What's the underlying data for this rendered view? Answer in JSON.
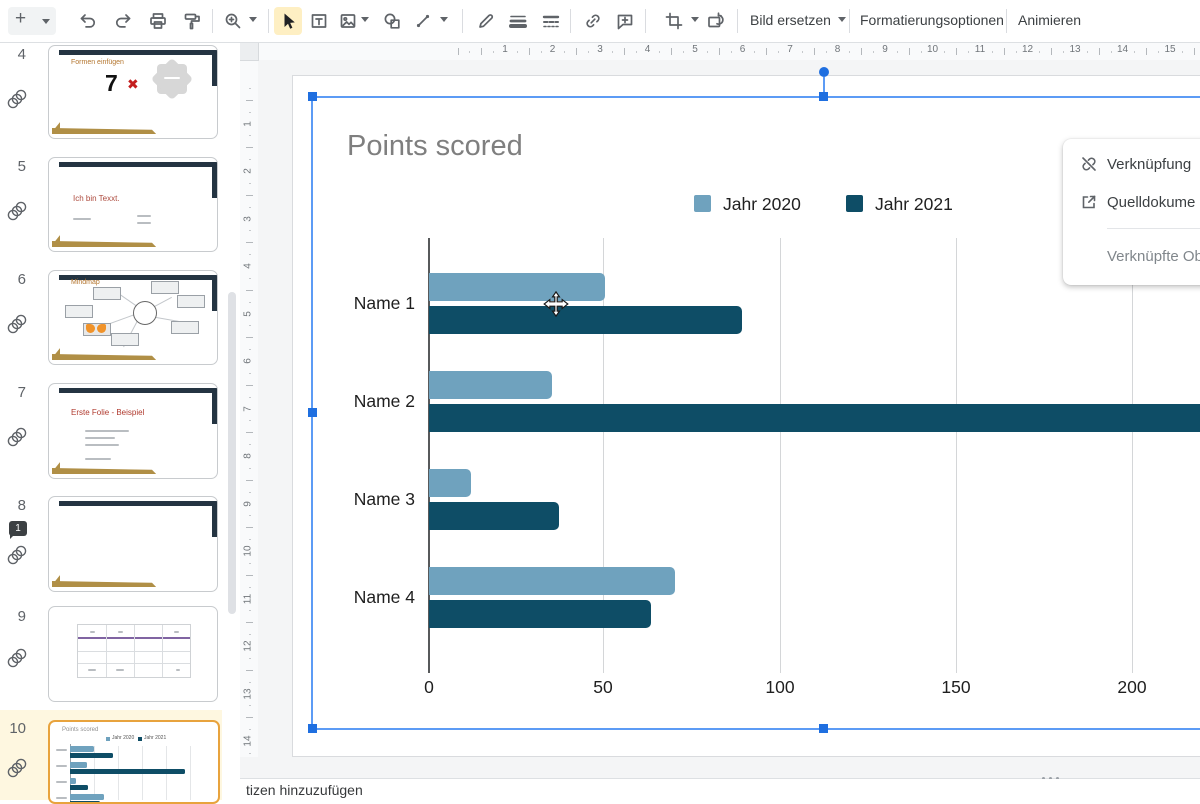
{
  "toolbar": {
    "buttons": {
      "replace_image": "Bild ersetzen",
      "format_options": "Formatierungsoptionen",
      "animate": "Animieren"
    },
    "icons": [
      "add-slide",
      "undo",
      "redo",
      "print",
      "paint-format",
      "zoom",
      "select-cursor",
      "text-box",
      "insert-image",
      "shape",
      "line",
      "border-color",
      "line-weight",
      "line-dash",
      "insert-link",
      "add-comment",
      "crop",
      "reset-image"
    ]
  },
  "rulers": {
    "horizontal": [
      "1",
      "2",
      "3",
      "4",
      "5",
      "6",
      "7",
      "8",
      "9",
      "10",
      "11",
      "12",
      "13",
      "14",
      "15"
    ],
    "vertical": [
      "1",
      "2",
      "3",
      "4",
      "5",
      "6",
      "7",
      "8",
      "9",
      "10",
      "11",
      "12",
      "13",
      "14"
    ]
  },
  "filmstrip": {
    "slides": [
      {
        "number": "4",
        "title": "Formen einfügen",
        "big_text": "7"
      },
      {
        "number": "5",
        "title": "Ich bin Texxt."
      },
      {
        "number": "6",
        "title": "Mindmap"
      },
      {
        "number": "7",
        "title": "Erste Folie - Beispiel"
      },
      {
        "number": "8",
        "comment_count": "1"
      },
      {
        "number": "9"
      },
      {
        "number": "10"
      }
    ]
  },
  "context_menu": {
    "items": [
      {
        "label": "Verknüpfung",
        "icon": "link-off-icon"
      },
      {
        "label": "Quelldokume",
        "icon": "open-in-new-icon"
      },
      {
        "label": "Verknüpfte Ob",
        "icon": null
      }
    ]
  },
  "notes": {
    "placeholder": "tizen hinzuzufügen"
  },
  "chart_data": {
    "type": "bar",
    "orientation": "horizontal",
    "title": "Points scored",
    "categories": [
      "Name 1",
      "Name 2",
      "Name 3",
      "Name 4"
    ],
    "series": [
      {
        "name": "Jahr 2020",
        "color": "#6FA2BE",
        "values": [
          50,
          35,
          12,
          70
        ]
      },
      {
        "name": "Jahr 2021",
        "color": "#0E4D66",
        "values": [
          89,
          240,
          37,
          63
        ]
      }
    ],
    "x_ticks": [
      "0",
      "50",
      "100",
      "150",
      "200"
    ],
    "xlim": [
      0,
      250
    ],
    "grid": true,
    "legend_position": "top"
  }
}
